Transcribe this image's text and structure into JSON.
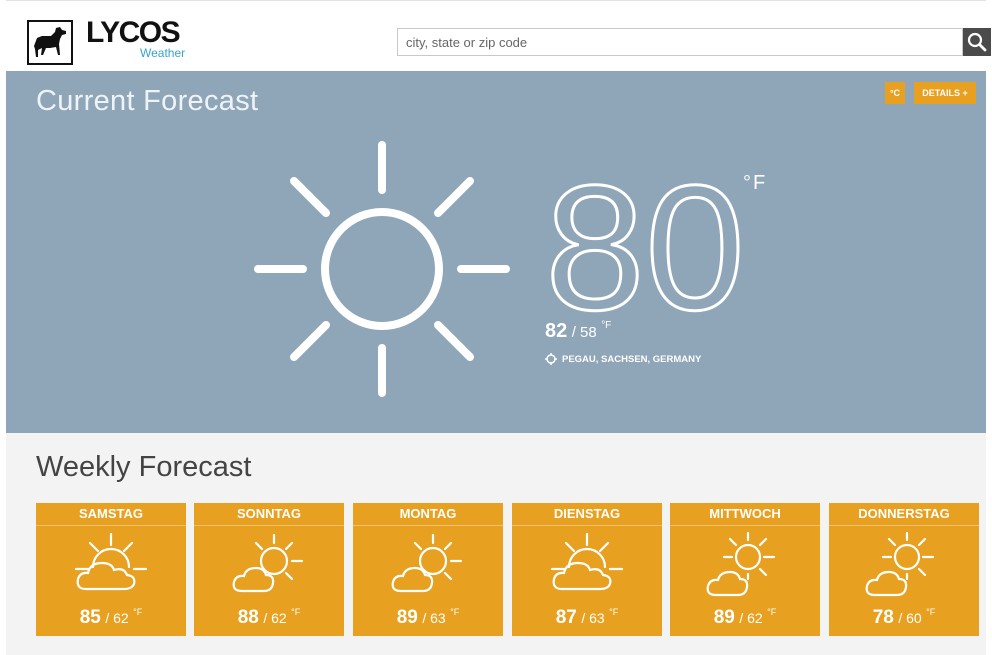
{
  "header": {
    "logo_text": "LYCOS",
    "logo_sub": "Weather",
    "search_placeholder": "city, state or zip code",
    "search_icon": "magnifier-icon"
  },
  "current": {
    "title": "Current Forecast",
    "unit_toggle": "°C",
    "details_label": "DETAILS +",
    "temperature": "80",
    "unit": "°F",
    "high": "82",
    "low": "/ 58",
    "hilo_unit": "°F",
    "location": "PEGAU, SACHSEN, GERMANY",
    "condition_icon": "sun-icon"
  },
  "weekly": {
    "title": "Weekly Forecast",
    "days": [
      {
        "name": "SAMSTAG",
        "high": "85",
        "low": "/ 62",
        "unit": "°F",
        "icon": "partly-cloudy-icon"
      },
      {
        "name": "SONNTAG",
        "high": "88",
        "low": "/ 62",
        "unit": "°F",
        "icon": "partly-cloudy-icon"
      },
      {
        "name": "MONTAG",
        "high": "89",
        "low": "/ 63",
        "unit": "°F",
        "icon": "partly-cloudy-icon"
      },
      {
        "name": "DIENSTAG",
        "high": "87",
        "low": "/ 63",
        "unit": "°F",
        "icon": "partly-cloudy-icon"
      },
      {
        "name": "MITTWOCH",
        "high": "89",
        "low": "/ 62",
        "unit": "°F",
        "icon": "sun-cloud-icon"
      },
      {
        "name": "DONNERSTAG",
        "high": "78",
        "low": "/ 60",
        "unit": "°F",
        "icon": "sun-cloud-icon"
      }
    ]
  },
  "colors": {
    "accent": "#e8a020",
    "panel": "#8fa5b8",
    "brand_sub": "#35a3c9"
  }
}
